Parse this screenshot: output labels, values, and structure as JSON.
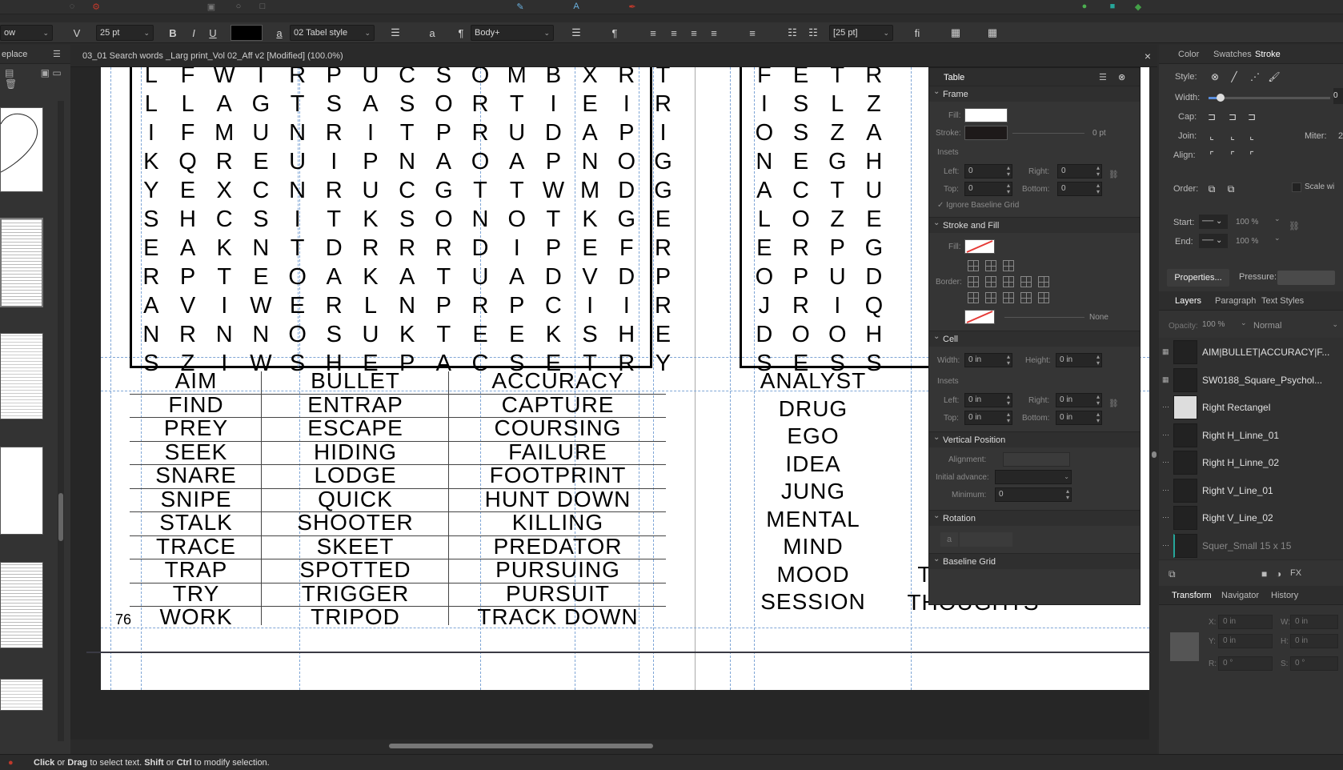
{
  "context_toolbar": {
    "style_value": "ow",
    "font_size": "25 pt",
    "bold": "B",
    "italic": "I",
    "underline": "U",
    "char_style": "a",
    "table_style": "02 Tabel style",
    "para_char": "a",
    "pilcrow": "¶",
    "para_style": "Body+",
    "pilcrow2": "¶",
    "size_box": "[25 pt]",
    "ligature": "fi"
  },
  "pages_panel": {
    "title": "eplace"
  },
  "document": {
    "tab_title": "03_01 Search words _Larg print_Vol 02_Aff v2 [Modified] (100.0%)",
    "close": "×",
    "page_number": "76"
  },
  "puzzle_left": {
    "rows": [
      "LFWIRPUCSOMBXRT",
      "LLAGTSASORTIEIR",
      "IFMUNRITPRUDAPI",
      "KQREUIPNAOAPNOG",
      "YEXCNRUCGTTWMDG",
      "SHCSITKSONOTKGE",
      "EAKNTDRRRDIPEFR",
      "RPTEOAKATUADVDP",
      "AVIWERLNPRPCIIR",
      "NRNNOSUKTEEKSHE",
      "SZIWSHEPACSETRY"
    ],
    "words": [
      [
        "AIM",
        "BULLET",
        "ACCURACY"
      ],
      [
        "FIND",
        "ENTRAP",
        "CAPTURE"
      ],
      [
        "PREY",
        "ESCAPE",
        "COURSING"
      ],
      [
        "SEEK",
        "HIDING",
        "FAILURE"
      ],
      [
        "SNARE",
        "LODGE",
        "FOOTPRINT"
      ],
      [
        "SNIPE",
        "QUICK",
        "HUNT DOWN"
      ],
      [
        "STALK",
        "SHOOTER",
        "KILLING"
      ],
      [
        "TRACE",
        "SKEET",
        "PREDATOR"
      ],
      [
        "TRAP",
        "SPOTTED",
        "PURSUING"
      ],
      [
        "TRY",
        "TRIGGER",
        "PURSUIT"
      ],
      [
        "WORK",
        "TRIPOD",
        "TRACK DOWN"
      ]
    ]
  },
  "puzzle_right": {
    "rows": [
      "FETR",
      "ISLZ",
      "OSZA",
      "NEGH",
      "ACTU",
      "LOZE",
      "ERPG",
      "OPUD",
      "JRIQ",
      "DOOH",
      "SESS"
    ],
    "words_col1": [
      "ANALYST",
      "DRUG",
      "EGO",
      "IDEA",
      "JUNG",
      "MENTAL",
      "MIND",
      "MOOD",
      "SESSION"
    ],
    "words_col2": [
      "THERAPY",
      "THOUGHTS"
    ]
  },
  "table_panel": {
    "title": "Table",
    "frame": {
      "header": "Frame",
      "fill_label": "Fill:",
      "stroke_label": "Stroke:",
      "stroke_value": "0 pt",
      "insets_label": "Insets",
      "left_label": "Left:",
      "left_value": "0",
      "right_label": "Right:",
      "right_value": "0",
      "top_label": "Top:",
      "top_value": "0",
      "bottom_label": "Bottom:",
      "bottom_value": "0",
      "ignore_baseline": "Ignore Baseline Grid"
    },
    "stroke_fill": {
      "header": "Stroke and Fill",
      "fill_label": "Fill:",
      "border_label": "Border:",
      "border_value": "None"
    },
    "cell": {
      "header": "Cell",
      "width_label": "Width:",
      "width_value": "0 in",
      "height_label": "Height:",
      "height_value": "0 in",
      "insets_label": "Insets",
      "left_label": "Left:",
      "left_value": "0 in",
      "right_label": "Right:",
      "right_value": "0 in",
      "top_label": "Top:",
      "top_value": "0 in",
      "bottom_label": "Bottom:",
      "bottom_value": "0 in"
    },
    "vertical_position": {
      "header": "Vertical Position",
      "alignment_label": "Alignment:",
      "initial_advance_label": "Initial advance:",
      "minimum_label": "Minimum:",
      "minimum_value": "0"
    },
    "rotation": {
      "header": "Rotation",
      "glyph": "a"
    },
    "baseline_grid": {
      "header": "Baseline Grid"
    }
  },
  "stroke_panel": {
    "tabs": [
      "Color",
      "Swatches",
      "Stroke"
    ],
    "style_label": "Style:",
    "width_label": "Width:",
    "width_value": "0",
    "cap_label": "Cap:",
    "join_label": "Join:",
    "miter_label": "Miter:",
    "miter_value": "2",
    "align_label": "Align:",
    "order_label": "Order:",
    "scale_label": "Scale wi",
    "start_label": "Start:",
    "start_pct": "100 %",
    "end_label": "End:",
    "end_pct": "100 %",
    "properties_button": "Properties...",
    "pressure_label": "Pressure:"
  },
  "layers_panel": {
    "tabs": [
      "Layers",
      "Paragraph",
      "Text Styles"
    ],
    "opacity_label": "Opacity:",
    "opacity_value": "100 %",
    "blend_mode": "Normal",
    "layers": [
      "AIM|BULLET|ACCURACY|F...",
      "SW0188_Square_Psychol...",
      "Right Rectangel",
      "Right H_Linne_01",
      "Right H_Linne_02",
      "Right V_Line_01",
      "Right V_Line_02",
      "Squer_Small 15 x 15"
    ]
  },
  "transform_panel": {
    "tabs": [
      "Transform",
      "Navigator",
      "History"
    ],
    "x_label": "X:",
    "x_value": "0 in",
    "w_label": "W:",
    "w_value": "0 in",
    "y_label": "Y:",
    "y_value": "0 in",
    "h_label": "H:",
    "h_value": "0 in",
    "r_label": "R:",
    "r_value": "0 °",
    "s_label": "S:",
    "s_value": "0 °"
  },
  "status": {
    "click": "Click",
    "or1": "or",
    "drag": "Drag",
    "text1": "to select text.",
    "shift": "Shift",
    "or2": "or",
    "ctrl": "Ctrl",
    "text2": "to modify selection."
  },
  "colors": {
    "accent": "#5a8ddb",
    "panel_bg": "#333333",
    "canvas_bg": "#262626",
    "guide": "#7fa6d6"
  }
}
